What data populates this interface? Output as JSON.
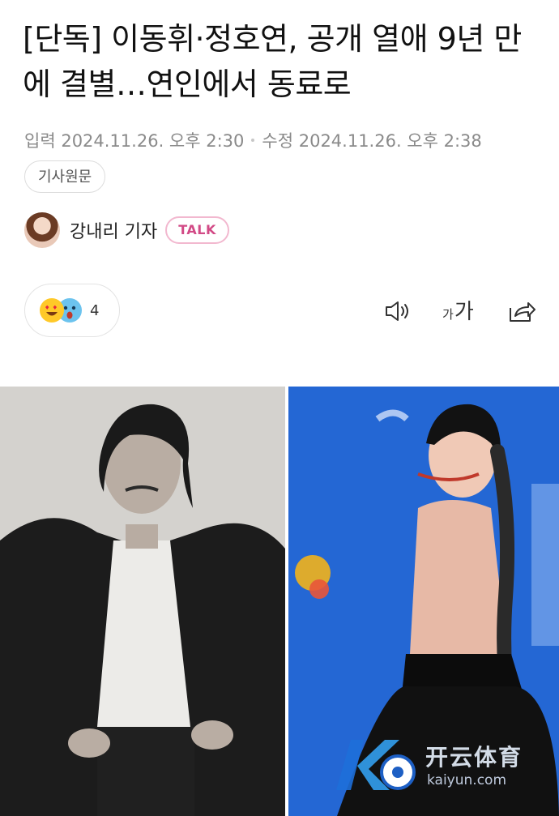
{
  "article": {
    "headline": "[단독] 이동휘·정호연, 공개 열애 9년 만에 결별…연인에서 동료로",
    "input_label": "입력",
    "input_time": "2024.11.26. 오후 2:30",
    "modified_label": "수정",
    "modified_time": "2024.11.26. 오후 2:38",
    "original_button": "기사원문"
  },
  "reporter": {
    "name": "강내리 기자",
    "talk_label": "TALK"
  },
  "reactions": {
    "count": "4",
    "emojis": [
      "heart-eyes-emoji",
      "shocked-emoji"
    ]
  },
  "toolbar": {
    "font_small": "가",
    "font_large": "가",
    "icons": [
      "speaker-icon",
      "font-size-icon",
      "share-icon"
    ]
  },
  "watermark": {
    "brand": "开云体育",
    "sub": "kaiyun.com"
  },
  "colors": {
    "talk_border": "#f2b8cf",
    "talk_text": "#d24a86",
    "photo_right_bg": "#2a6fd8"
  }
}
